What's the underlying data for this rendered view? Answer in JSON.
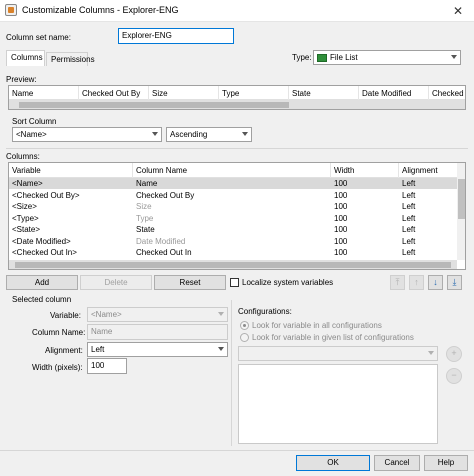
{
  "window": {
    "title": "Customizable Columns - Explorer-ENG",
    "close_glyph": "✕"
  },
  "column_set": {
    "label": "Column set name:",
    "value": "Explorer-ENG"
  },
  "tabs": [
    {
      "label": "Columns",
      "active": true
    },
    {
      "label": "Permissions",
      "active": false
    }
  ],
  "type": {
    "label": "Type:",
    "value": "File List",
    "icon": "file-list-icon"
  },
  "preview": {
    "label": "Preview:",
    "headers": [
      "Name",
      "Checked Out By",
      "Size",
      "Type",
      "State",
      "Date Modified",
      "Checked Ou"
    ]
  },
  "sort": {
    "label": "Sort Column",
    "column_value": "<Name>",
    "order_value": "Ascending"
  },
  "columns": {
    "label": "Columns:",
    "headers": [
      "Variable",
      "Column Name",
      "Width",
      "Alignment"
    ],
    "rows": [
      {
        "variable": "<Name>",
        "column_name": "Name",
        "width": "100",
        "alignment": "Left",
        "dim": false,
        "selected": true
      },
      {
        "variable": "<Checked Out By>",
        "column_name": "Checked Out By",
        "width": "100",
        "alignment": "Left",
        "dim": false,
        "selected": false
      },
      {
        "variable": "<Size>",
        "column_name": "Size",
        "width": "100",
        "alignment": "Left",
        "dim": true,
        "selected": false
      },
      {
        "variable": "<Type>",
        "column_name": "Type",
        "width": "100",
        "alignment": "Left",
        "dim": true,
        "selected": false
      },
      {
        "variable": "<State>",
        "column_name": "State",
        "width": "100",
        "alignment": "Left",
        "dim": false,
        "selected": false
      },
      {
        "variable": "<Date Modified>",
        "column_name": "Date Modified",
        "width": "100",
        "alignment": "Left",
        "dim": true,
        "selected": false
      },
      {
        "variable": "<Checked Out In>",
        "column_name": "Checked Out In",
        "width": "100",
        "alignment": "Left",
        "dim": false,
        "selected": false
      }
    ]
  },
  "actions": {
    "add": "Add",
    "delete": "Delete",
    "reset": "Reset",
    "localize": "Localize system variables"
  },
  "move": {
    "top": "⤒",
    "up": "↑",
    "down": "↓",
    "bottom": "⤓"
  },
  "selected_column": {
    "label": "Selected column",
    "variable_label": "Variable:",
    "variable_value": "<Name>",
    "column_name_label": "Column Name:",
    "column_name_value": "Name",
    "alignment_label": "Alignment:",
    "alignment_value": "Left",
    "width_label": "Width (pixels):",
    "width_value": "100"
  },
  "configurations": {
    "label": "Configurations:",
    "option_all": "Look for variable in all configurations",
    "option_list": "Look for variable in given list of configurations",
    "add_glyph": "+",
    "remove_glyph": "−"
  },
  "footer": {
    "ok": "OK",
    "cancel": "Cancel",
    "help": "Help"
  }
}
